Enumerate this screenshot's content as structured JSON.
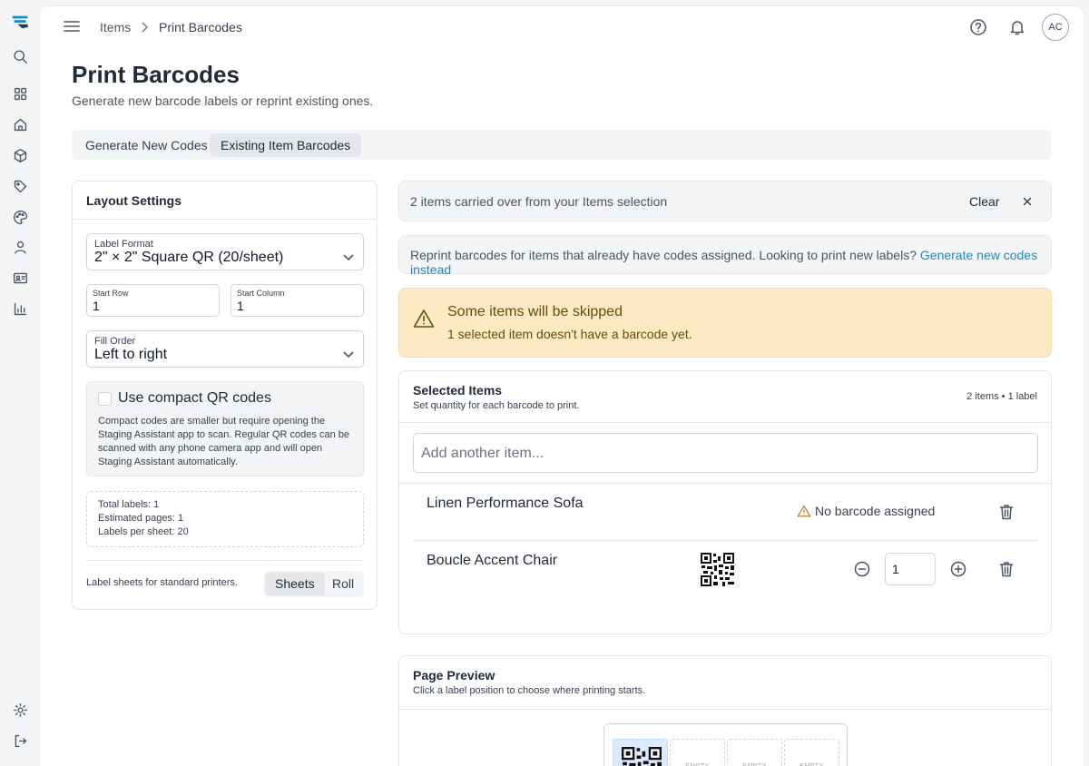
{
  "breadcrumb": {
    "parent": "Items",
    "current": "Print Barcodes"
  },
  "user": {
    "initials": "AC"
  },
  "page": {
    "title": "Print Barcodes",
    "subtitle": "Generate new barcode labels or reprint existing ones."
  },
  "tabs": [
    {
      "label": "Generate New Codes",
      "active": false
    },
    {
      "label": "Existing Item Barcodes",
      "active": true
    }
  ],
  "layout_settings": {
    "title": "Layout Settings",
    "label_format": {
      "label": "Label Format",
      "value": "2\" × 2\" Square QR (20/sheet)"
    },
    "start_row": {
      "label": "Start Row",
      "value": "1"
    },
    "start_column": {
      "label": "Start Column",
      "value": "1"
    },
    "fill_order": {
      "label": "Fill Order",
      "value": "Left to right"
    },
    "compact": {
      "label": "Use compact QR codes",
      "checked": false,
      "description": "Compact codes are smaller but require opening the Staging Assistant app to scan. Regular QR codes can be scanned with any phone camera app and will open Staging Assistant automatically."
    },
    "totals": {
      "total_labels": "Total labels: 1",
      "estimated_pages": "Estimated pages: 1",
      "labels_per_sheet": "Labels per sheet: 20"
    },
    "sheet_note": "Label sheets for standard printers.",
    "media": {
      "options": [
        "Sheets",
        "Roll"
      ],
      "selected": "Sheets"
    }
  },
  "carried_banner": {
    "text": "2 items carried over from your Items selection",
    "clear_label": "Clear"
  },
  "reprint_banner": {
    "text": "Reprint barcodes for items that already have codes assigned. Looking to print new labels?",
    "link": "Generate new codes instead"
  },
  "warning": {
    "title": "Some items will be skipped",
    "message": "1 selected item doesn't have a barcode yet."
  },
  "selected_items": {
    "title": "Selected Items",
    "subtitle": "Set quantity for each barcode to print.",
    "count": "2 items • 1 label",
    "add_placeholder": "Add another item...",
    "items": [
      {
        "name": "Linen Performance Sofa",
        "status": "No barcode assigned"
      },
      {
        "name": "Boucle Accent Chair",
        "quantity": "1"
      }
    ]
  },
  "preview": {
    "title": "Page Preview",
    "subtitle": "Click a label position to choose where printing starts.",
    "empty_label": "EMPTY"
  },
  "colors": {
    "accent": "#1d8ac4",
    "warning_bg": "#fde9c4",
    "warning_text": "#6b4a0b"
  }
}
